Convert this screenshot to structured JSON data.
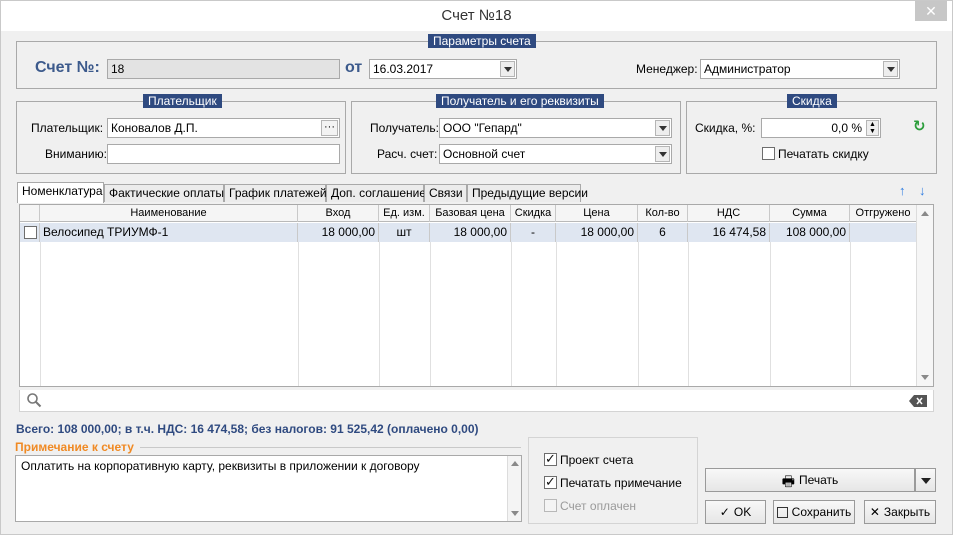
{
  "window": {
    "title": "Счет №18",
    "close_glyph": "✕"
  },
  "params": {
    "legend": "Параметры счета",
    "number_label": "Счет №:",
    "number_value": "18",
    "date_label": "от",
    "date_value": "16.03.2017",
    "manager_label": "Менеджер:",
    "manager_value": "Администратор"
  },
  "payer": {
    "legend": "Плательщик",
    "payer_label": "Плательщик:",
    "payer_value": "Коновалов Д.П.",
    "attention_label": "Вниманию:",
    "attention_value": ""
  },
  "recipient": {
    "legend": "Получатель и его реквизиты",
    "recipient_label": "Получатель:",
    "recipient_value": "ООО \"Гепард\"",
    "account_label": "Расч. счет:",
    "account_value": "Основной счет"
  },
  "discount": {
    "legend": "Скидка",
    "discount_label": "Скидка, %:",
    "discount_value": "0,0 %",
    "print_discount_label": "Печатать скидку",
    "print_discount_checked": false
  },
  "tabs": [
    {
      "label": "Номенклатура",
      "active": true
    },
    {
      "label": "Фактические оплаты",
      "active": false
    },
    {
      "label": "График платежей",
      "active": false
    },
    {
      "label": "Доп. соглашение",
      "active": false
    },
    {
      "label": "Связи",
      "active": false
    },
    {
      "label": "Предыдущие версии",
      "active": false
    }
  ],
  "table": {
    "columns": [
      "",
      "Наименование",
      "Вход",
      "Ед. изм.",
      "Базовая цена",
      "Скидка",
      "Цена",
      "Кол-во",
      "НДС",
      "Сумма",
      "Отгружено"
    ],
    "rows": [
      [
        "",
        "Велосипед ТРИУМФ-1",
        "18 000,00",
        "шт",
        "18 000,00",
        "-",
        "18 000,00",
        "6",
        "16 474,58",
        "108 000,00",
        ""
      ]
    ]
  },
  "summary": "Всего: 108 000,00; в т.ч. НДС: 16 474,58; без налогов: 91 525,42 (оплачено 0,00)",
  "note": {
    "label": "Примечание к счету",
    "text": "Оплатить на корпоративную карту, реквизиты в приложении к договору"
  },
  "options": {
    "draft_label": "Проект счета",
    "draft_checked": true,
    "print_note_label": "Печатать примечание",
    "print_note_checked": true,
    "paid_label": "Счет оплачен",
    "paid_checked": false,
    "paid_disabled": true
  },
  "buttons": {
    "print": "Печать",
    "ok": "OK",
    "save": "Сохранить",
    "close": "Закрыть"
  },
  "colors": {
    "legend_bg": "#2f4a80",
    "header_text": "#3c5a8c",
    "accent_orange": "#f08a24",
    "selected_row": "#dfe6f1"
  }
}
